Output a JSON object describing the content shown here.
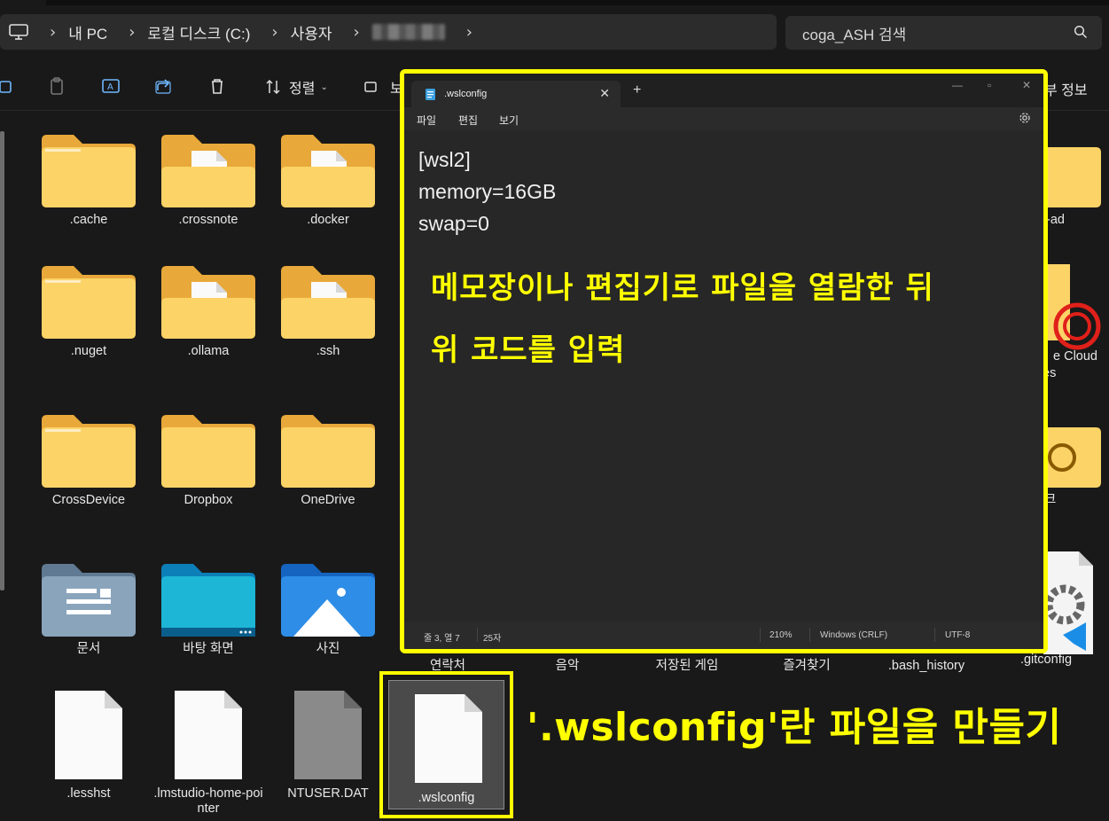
{
  "address_bar": {
    "crumbs": [
      "내 PC",
      "로컬 디스크 (C:)",
      "사용자"
    ],
    "search_placeholder": "coga_ASH 검색"
  },
  "toolbar": {
    "sort_label": "정렬",
    "view_label_partial": "보",
    "details_label_partial": "부 정보"
  },
  "files": {
    "row1": [
      ".cache",
      ".crossnote",
      ".docker",
      "-ad"
    ],
    "row2": [
      ".nuget",
      ".ollama",
      ".ssh",
      "e Cloud",
      "es"
    ],
    "row3": [
      "CrossDevice",
      "Dropbox",
      "OneDrive",
      "크"
    ],
    "row4": [
      "문서",
      "바탕 화면",
      "사진",
      "연락처",
      "음악",
      "저장된 게임",
      "즐겨찾기",
      ".bash_history",
      ".gitconfig"
    ],
    "row5": [
      ".lesshst",
      ".lmstudio-home-pointer",
      "NTUSER.DAT",
      ".wslconfig"
    ]
  },
  "notepad": {
    "tab_title": ".wslconfig",
    "close_glyph": "✕",
    "plus_glyph": "+",
    "menu": [
      "파일",
      "편집",
      "보기"
    ],
    "lines": [
      "[wsl2]",
      "memory=16GB",
      "swap=0"
    ],
    "status": {
      "position": "줄 3, 열 7",
      "chars": "25자",
      "zoom": "210%",
      "line_ending": "Windows (CRLF)",
      "encoding": "UTF-8"
    }
  },
  "annotations": {
    "overlay_line1": "메모장이나 편집기로 파일을 열람한 뒤",
    "overlay_line2": "위 코드를 입력",
    "caption": "'.wslconfig'란 파일을 만들기",
    "highlight_color": "#ffff00"
  }
}
